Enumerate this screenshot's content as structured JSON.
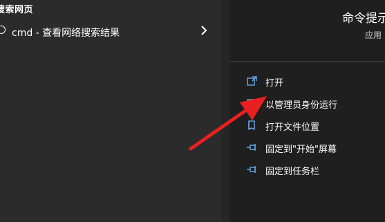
{
  "left": {
    "section_header": "搜索网页",
    "result": {
      "query": "cmd",
      "description": " - 查看网络搜索结果",
      "icon": "search-icon",
      "chevron_icon": "chevron-right-icon"
    }
  },
  "right": {
    "app_title": "命令提示",
    "app_type": "应用",
    "actions": [
      {
        "label": "打开",
        "icon": "open-icon"
      },
      {
        "label": "以管理员身份运行",
        "icon": "admin-shield-icon"
      },
      {
        "label": "打开文件位置",
        "icon": "folder-location-icon"
      },
      {
        "label": "固定到\"开始\"屏幕",
        "icon": "pin-icon"
      },
      {
        "label": "固定到任务栏",
        "icon": "pin-icon"
      }
    ]
  },
  "annotation": {
    "icon": "red-arrow-icon",
    "color": "#e8201f"
  },
  "colors": {
    "icon_accent": "#6fb7ff"
  }
}
